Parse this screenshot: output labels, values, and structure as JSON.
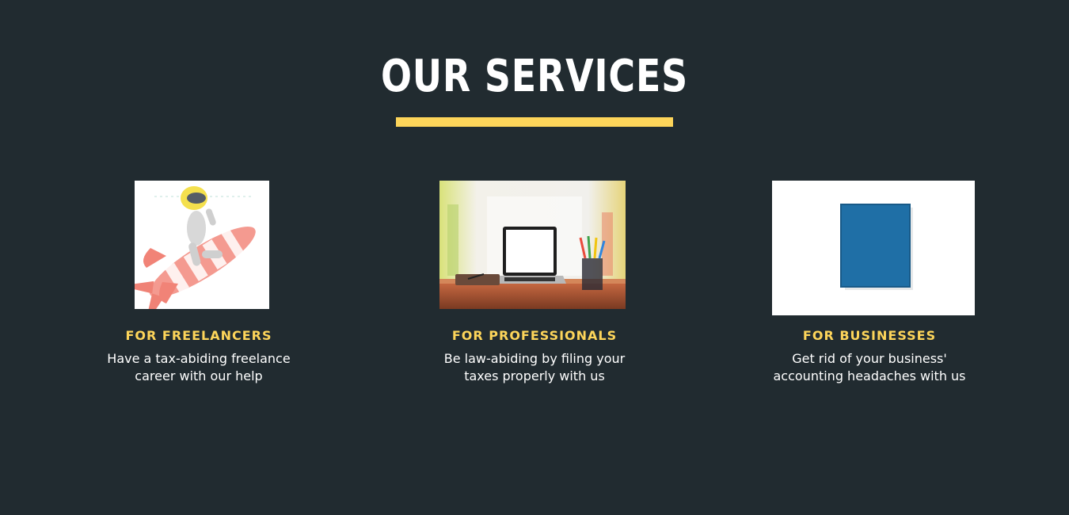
{
  "section": {
    "title": "OUR SERVICES",
    "accent_color": "#fdd55a",
    "background_color": "#212b30"
  },
  "services": [
    {
      "title": "FOR FREELANCERS",
      "description": "Have a tax-abiding freelance career with our help",
      "image": "figure-riding-rocket-illustration"
    },
    {
      "title": "FOR PROFESSIONALS",
      "description": "Be law-abiding by filing your taxes properly with us",
      "image": "laptop-on-desk-photo"
    },
    {
      "title": "FOR BUSINESSES",
      "description": "Get rid of your business' accounting headaches with us",
      "image": "blue-book-cover-photo"
    }
  ]
}
